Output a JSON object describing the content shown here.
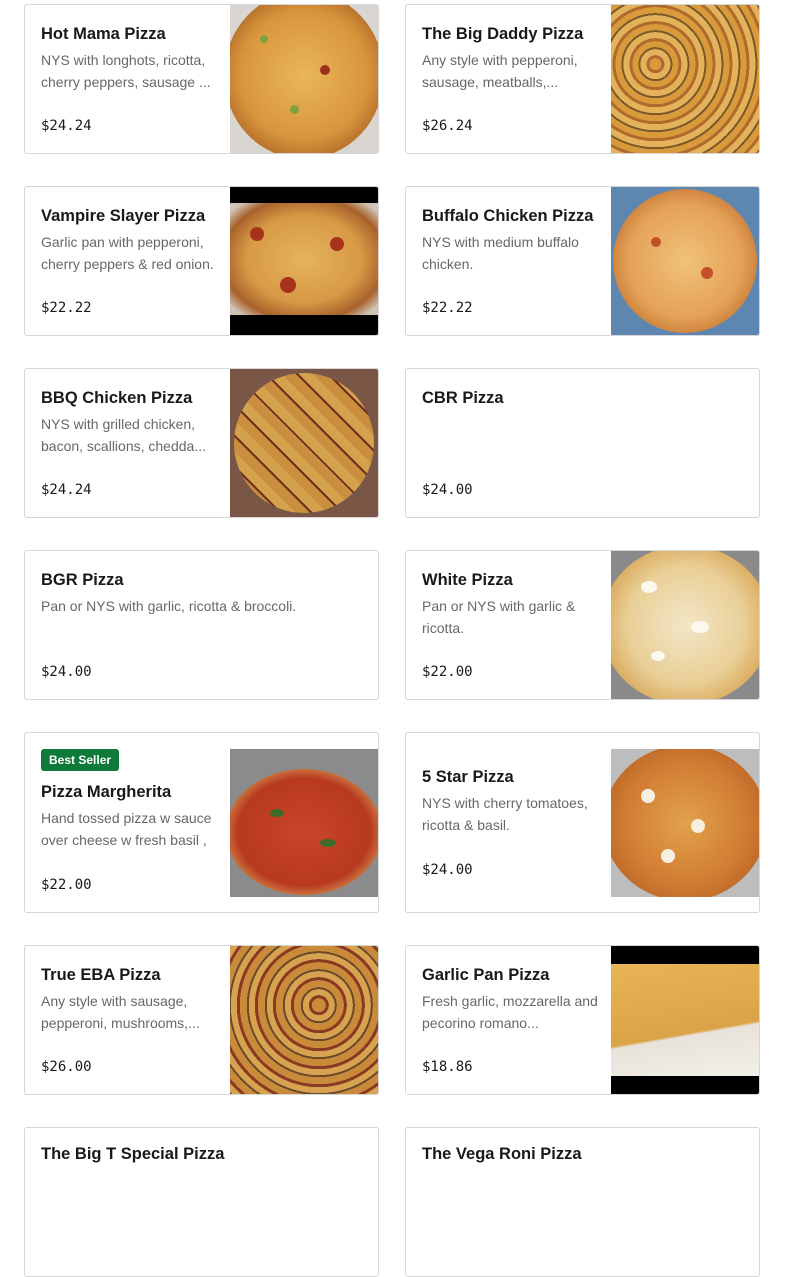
{
  "items": [
    {
      "name": "Hot Mama Pizza",
      "desc": "NYS with longhots, ricotta, cherry peppers, sausage ...",
      "price": "$24.24",
      "image": "pizza-photo"
    },
    {
      "name": "The Big Daddy Pizza",
      "desc": "Any style with pepperoni, sausage, meatballs,...",
      "price": "$26.24",
      "image": "pizza-photo"
    },
    {
      "name": "Vampire Slayer Pizza",
      "desc": "Garlic pan with pepperoni, cherry peppers & red onion.",
      "price": "$22.22",
      "image": "pizza-photo"
    },
    {
      "name": "Buffalo Chicken Pizza",
      "desc": "NYS with medium buffalo chicken.",
      "price": "$22.22",
      "image": "pizza-photo"
    },
    {
      "name": "BBQ Chicken Pizza",
      "desc": "NYS with grilled chicken, bacon, scallions, chedda...",
      "price": "$24.24",
      "image": "pizza-photo"
    },
    {
      "name": "CBR Pizza",
      "desc": "",
      "price": "$24.00",
      "image": ""
    },
    {
      "name": "BGR Pizza",
      "desc": "Pan or NYS with garlic, ricotta & broccoli.",
      "price": "$24.00",
      "image": ""
    },
    {
      "name": "White Pizza",
      "desc": "Pan or NYS with garlic & ricotta.",
      "price": "$22.00",
      "image": "pizza-photo"
    },
    {
      "name": "Pizza Margherita",
      "badge": "Best Seller",
      "desc": "Hand tossed pizza w sauce over cheese w fresh basil ,",
      "price": "$22.00",
      "image": "pizza-photo"
    },
    {
      "name": "5 Star Pizza",
      "desc": "NYS with cherry tomatoes, ricotta & basil.",
      "price": "$24.00",
      "image": "pizza-photo"
    },
    {
      "name": "True EBA Pizza",
      "desc": "Any style with sausage, pepperoni, mushrooms,...",
      "price": "$26.00",
      "image": "pizza-photo"
    },
    {
      "name": "Garlic Pan Pizza",
      "desc": "Fresh garlic, mozzarella and pecorino romano...",
      "price": "$18.86",
      "image": "pizza-photo"
    },
    {
      "name": "The Big T Special Pizza",
      "desc": "",
      "price": "",
      "image": ""
    },
    {
      "name": "The Vega Roni Pizza",
      "desc": "",
      "price": "",
      "image": ""
    }
  ],
  "colors": {
    "badge_bg": "#0e7a3a",
    "border": "#d6d6d6",
    "desc_text": "#676767"
  }
}
